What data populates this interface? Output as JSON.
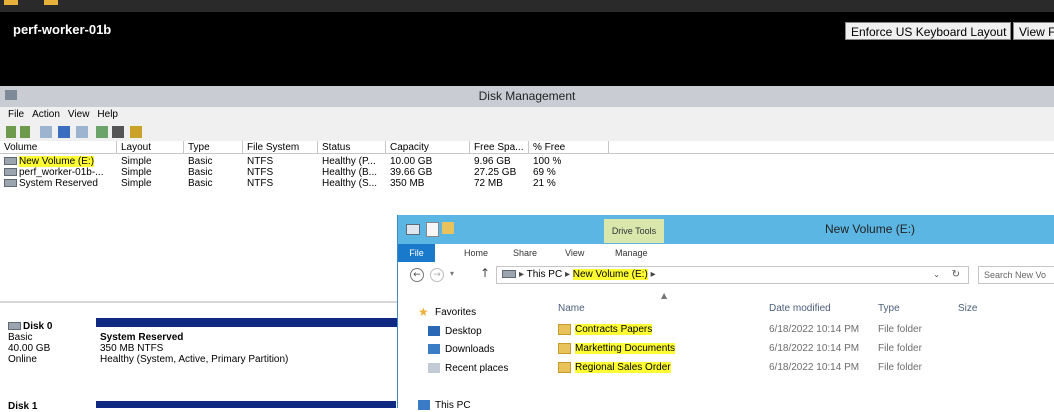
{
  "remote": {
    "host": "perf-worker-01b",
    "buttons": [
      "Enforce US Keyboard Layout",
      "View F"
    ]
  },
  "disk_management": {
    "title": "Disk Management",
    "menu": [
      "File",
      "Action",
      "View",
      "Help"
    ],
    "columns": [
      "Volume",
      "Layout",
      "Type",
      "File System",
      "Status",
      "Capacity",
      "Free Spa...",
      "% Free"
    ],
    "rows": [
      [
        "New Volume (E:)",
        "Simple",
        "Basic",
        "NTFS",
        "Healthy (P...",
        "10.00 GB",
        "9.96 GB",
        "100 %"
      ],
      [
        "perf_worker-01b-...",
        "Simple",
        "Basic",
        "NTFS",
        "Healthy (B...",
        "39.66 GB",
        "27.25 GB",
        "69 %"
      ],
      [
        "System Reserved",
        "Simple",
        "Basic",
        "NTFS",
        "Healthy (S...",
        "350 MB",
        "72 MB",
        "21 %"
      ]
    ],
    "disk0": {
      "name": "Disk 0",
      "type": "Basic",
      "size": "40.00 GB",
      "state": "Online",
      "partition_name": "System Reserved",
      "partition_size": "350 MB NTFS",
      "partition_status": "Healthy (System, Active, Primary Partition)"
    },
    "disk1_label": "Disk 1"
  },
  "explorer": {
    "contextual_tab": "Drive Tools",
    "title": "New Volume (E:)",
    "ribbon_tabs": [
      "File",
      "Home",
      "Share",
      "View",
      "Manage"
    ],
    "address": {
      "root": "This PC",
      "current": "New Volume (E:)"
    },
    "search_placeholder": "Search New Vo",
    "nav": {
      "favorites": "Favorites",
      "items": [
        "Desktop",
        "Downloads",
        "Recent places"
      ],
      "this_pc": "This PC"
    },
    "columns": [
      "Name",
      "Date modified",
      "Type",
      "Size"
    ],
    "files": [
      {
        "name": "Contracts Papers",
        "date": "6/18/2022 10:14 PM",
        "type": "File folder"
      },
      {
        "name": "Marketting Documents",
        "date": "6/18/2022 10:14 PM",
        "type": "File folder"
      },
      {
        "name": "Regional Sales Order",
        "date": "6/18/2022 10:14 PM",
        "type": "File folder"
      }
    ]
  },
  "colors": {
    "highlight": "#ffff33",
    "explorer_title": "#5bb6e3",
    "disk_bar": "#102a83"
  }
}
